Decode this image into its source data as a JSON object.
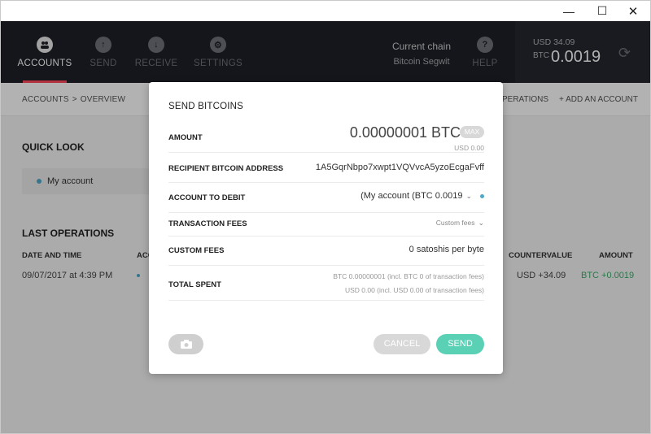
{
  "window": {
    "min_glyph": "—",
    "max_glyph": "☐",
    "close_glyph": "✕"
  },
  "nav": {
    "items": [
      {
        "label": "ACCOUNTS",
        "icon": "accounts-icon",
        "active": true
      },
      {
        "label": "SEND",
        "icon": "send-icon",
        "active": false
      },
      {
        "label": "RECEIVE",
        "icon": "receive-icon",
        "active": false
      },
      {
        "label": "SETTINGS",
        "icon": "settings-icon",
        "active": false
      },
      {
        "label": "HELP",
        "icon": "help-icon",
        "active": false
      }
    ],
    "chain_label": "Current chain",
    "chain_value": "Bitcoin Segwit",
    "balance_usd": "USD 34.09",
    "balance_unit": "BTC",
    "balance_value": "0.0019"
  },
  "breadcrumb": {
    "root": "ACCOUNTS",
    "sep": ">",
    "current": "OVERVIEW"
  },
  "actions": {
    "operations": "PERATIONS",
    "add_account": "ADD AN ACCOUNT"
  },
  "quick_look": {
    "title": "QUICK LOOK",
    "account": "My account"
  },
  "last_operations": {
    "title": "LAST OPERATIONS",
    "headers": {
      "date": "DATE AND TIME",
      "account": "ACC",
      "countervalue": "COUNTERVALUE",
      "amount": "AMOUNT"
    },
    "rows": [
      {
        "date": "09/07/2017 at 4:39 PM",
        "countervalue": "USD +34.09",
        "amount": "BTC +0.0019"
      }
    ]
  },
  "modal": {
    "title": "SEND BITCOINS",
    "amount_label": "AMOUNT",
    "amount_value": "0.00000001 BTC",
    "max_label": "MAX",
    "amount_usd": "USD 0.00",
    "recipient_label": "RECIPIENT BITCOIN ADDRESS",
    "recipient_value": "1A5GqrNbpo7xwpt1VQVvcA5yzoEcgaFvff",
    "account_label": "ACCOUNT TO DEBIT",
    "account_value": "(My account (BTC 0.0019",
    "fees_label": "TRANSACTION FEES",
    "fees_value": "Custom fees",
    "custom_fees_label": "CUSTOM FEES",
    "custom_fees_value": "0 satoshis per byte",
    "total_label": "TOTAL SPENT",
    "total_btc": "BTC 0.00000001 (incl. BTC 0 of transaction fees)",
    "total_usd": "USD 0.00 (incl. USD 0.00 of transaction fees)",
    "cancel_label": "CANCEL",
    "send_label": "SEND"
  },
  "colors": {
    "nav_bg": "#1d2027",
    "accent_red": "#ff4a5b",
    "send_green": "#5ad0b4",
    "positive": "#3cae6b",
    "dot_blue": "#4ea8c8"
  }
}
